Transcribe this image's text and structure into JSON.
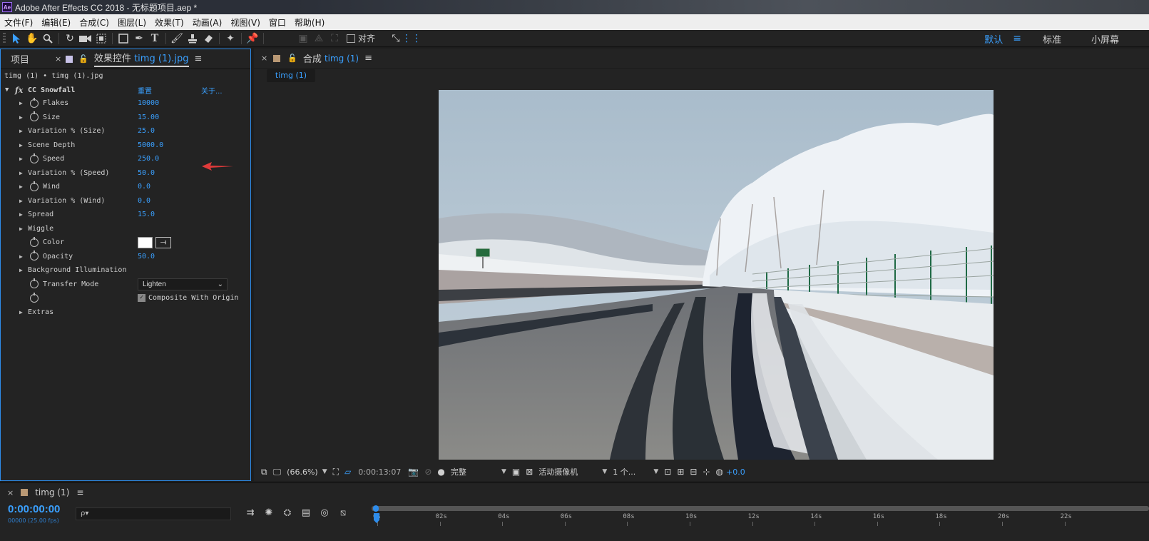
{
  "window": {
    "title": "Adobe After Effects CC 2018 - 无标题项目.aep *",
    "logo": "Ae"
  },
  "menu": [
    "文件(F)",
    "编辑(E)",
    "合成(C)",
    "图层(L)",
    "效果(T)",
    "动画(A)",
    "视图(V)",
    "窗口",
    "帮助(H)"
  ],
  "toolbar": {
    "align_label": "对齐",
    "workspaces": [
      "默认",
      "标准",
      "小屏幕"
    ],
    "workspace_menu": "≡"
  },
  "left_panel": {
    "tab_project": "项目",
    "tab_effects": "效果控件",
    "tab_effects_layer": "timg (1).jpg",
    "tab_menu": "≡",
    "breadcrumb": "timg (1) • timg (1).jpg",
    "effect": {
      "name": "CC Snowfall",
      "reset": "重置",
      "about": "关于..."
    },
    "properties": [
      {
        "name": "Flakes",
        "value": "10000",
        "arrow": true,
        "stopwatch": true
      },
      {
        "name": "Size",
        "value": "15.00",
        "arrow": true,
        "stopwatch": true
      },
      {
        "name": "Variation % (Size)",
        "value": "25.0",
        "arrow": true,
        "stopwatch": false
      },
      {
        "name": "Scene Depth",
        "value": "5000.0",
        "arrow": true,
        "stopwatch": false
      },
      {
        "name": "Speed",
        "value": "250.0",
        "arrow": true,
        "stopwatch": true
      },
      {
        "name": "Variation % (Speed)",
        "value": "50.0",
        "arrow": true,
        "stopwatch": false
      },
      {
        "name": "Wind",
        "value": "0.0",
        "arrow": true,
        "stopwatch": true
      },
      {
        "name": "Variation % (Wind)",
        "value": "0.0",
        "arrow": true,
        "stopwatch": false
      },
      {
        "name": "Spread",
        "value": "15.0",
        "arrow": true,
        "stopwatch": false
      },
      {
        "name": "Wiggle",
        "value": "",
        "arrow": true,
        "stopwatch": false
      },
      {
        "name": "Color",
        "value": "",
        "arrow": false,
        "stopwatch": true
      },
      {
        "name": "Opacity",
        "value": "50.0",
        "arrow": true,
        "stopwatch": true
      },
      {
        "name": "Background Illumination",
        "value": "",
        "arrow": true,
        "stopwatch": false
      },
      {
        "name": "Transfer Mode",
        "value": "",
        "arrow": false,
        "stopwatch": true
      },
      {
        "name": "",
        "value": "",
        "arrow": false,
        "stopwatch": true
      },
      {
        "name": "Extras",
        "value": "",
        "arrow": true,
        "stopwatch": false
      }
    ],
    "transfer_mode": "Lighten",
    "composite_with_origin": "Composite With Origin",
    "color_value": "#ffffff"
  },
  "comp_panel": {
    "tab_label": "合成",
    "tab_name": "timg (1)",
    "tab_menu": "≡",
    "flow_tab": "timg (1)",
    "footer": {
      "zoom": "(66.6%)",
      "timecode": "0:00:13:07",
      "resolution": "完整",
      "camera": "活动摄像机",
      "views": "1 个...",
      "exposure": "+0.0"
    }
  },
  "timeline": {
    "comp_name": "timg (1)",
    "menu": "≡",
    "timecode": "0:00:00:00",
    "frames": "00000 (25.00 fps)",
    "search_placeholder": "ρ▾",
    "ruler_labels": [
      "0s",
      "02s",
      "04s",
      "06s",
      "08s",
      "10s",
      "12s",
      "14s",
      "16s",
      "18s",
      "20s",
      "22s"
    ]
  },
  "colors": {
    "accent": "#3aa0ff",
    "panel_bg": "#232323",
    "app_bg": "#1d1d1d",
    "annotation_arrow": "#e03a3a"
  }
}
